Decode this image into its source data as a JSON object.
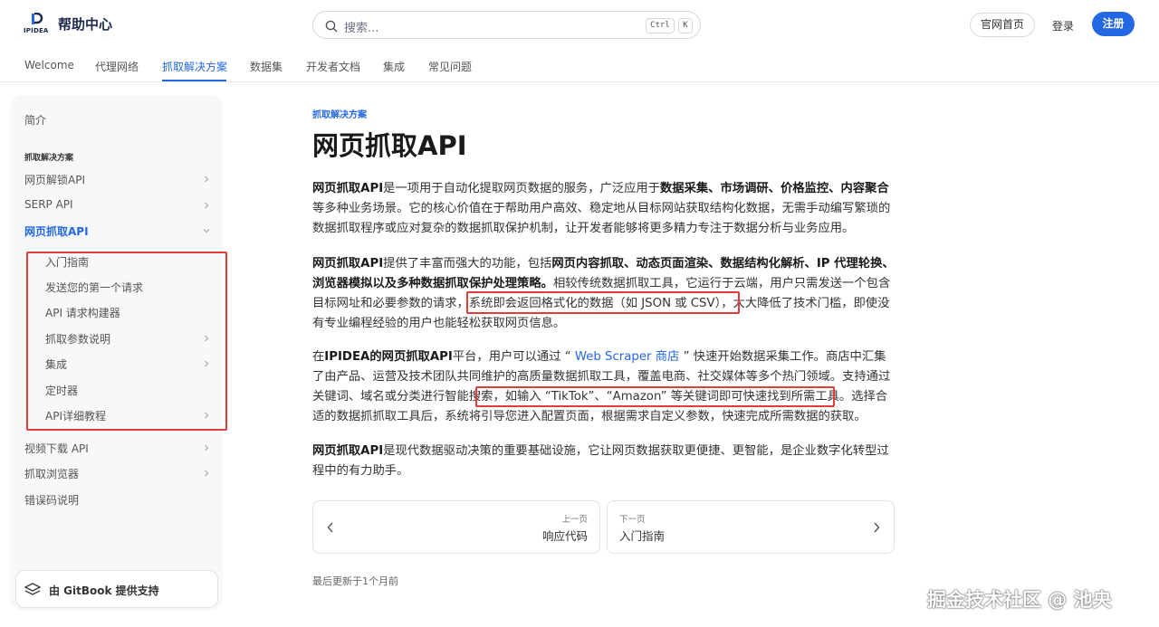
{
  "header": {
    "logo_text": "IPIDEA",
    "site_title": "帮助中心",
    "search_placeholder": "搜索...",
    "kbd_ctrl": "Ctrl",
    "kbd_k": "K",
    "official_site": "官网首页",
    "login": "登录",
    "register": "注册",
    "accent_color": "#2467e3"
  },
  "nav": {
    "items": [
      "Welcome",
      "代理网络",
      "抓取解决方案",
      "数据集",
      "开发者文档",
      "集成",
      "常见问题"
    ],
    "active": "抓取解决方案"
  },
  "sidebar": {
    "intro": "简介",
    "section": "抓取解决方案",
    "items": [
      "网页解锁API",
      "SERP API",
      "网页抓取API"
    ],
    "sub_items": [
      "入门指南",
      "发送您的第一个请求",
      "API 请求构建器",
      "抓取参数说明",
      "集成",
      "定时器",
      "API详细教程"
    ],
    "bottom_items": [
      "视频下载 API",
      "抓取浏览器",
      "错误码说明"
    ],
    "gitbook": "由 GitBook 提供支持"
  },
  "main": {
    "breadcrumb": "抓取解决方案",
    "title": "网页抓取API",
    "p1": {
      "a": "网页抓取API",
      "b": "是一项用于自动化提取网页数据的服务，广泛应用于",
      "c": "数据采集、市场调研、价格监控、内容聚合",
      "d": "等多种业务场景。它的核心价值在于帮助用户高效、稳定地从目标网站获取结构化数据，无需手动编写繁琐的数据抓取程序或应对复杂的数据抓取保护机制，让开发者能够将更多精力专注于数据分析与业务应用。"
    },
    "p2": {
      "a": "网页抓取API",
      "b": "提供了丰富而强大的功能，包括",
      "c": "网页内容抓取、动态页面渲染、数据结构化解析、IP 代理轮换、浏览器模拟以及多种数据抓取保护处理策略。",
      "d": "相较传统数据抓取工具，它运行于云端，用户只需发送一个包含目标网址和必要参数的请求，",
      "e": "系统即会返回格式化的数据（如 JSON 或 CSV）",
      "f": "，大大降低了技术门槛，即使没有专业编程经验的用户也能轻松获取网页信息。"
    },
    "p3": {
      "a": "在",
      "b": "IPIDEA的网页抓取API",
      "c": "平台，用户可以通过 “ ",
      "link": "Web Scraper 商店",
      "d": " ” 快速开始数据采集工作。商店中汇集了由产品、运营及技术团队共同维护的高质量数据抓取工具，覆盖电商、社交媒体等多个热门领域。支持通过关键词、域名或分类进行智能搜索，",
      "e": "如输入 “TikTok”、“Amazon” 等关键词即可快速找到所需工具。",
      "f": "选择合适的数据抓抓取工具后，系统将引导您进入配置页面，根据需求自定义参数，快速完成所需数据的获取。"
    },
    "p4": {
      "a": "网页抓取API",
      "b": "是现代数据驱动决策的重要基础设施，它让网页数据获取更便捷、更智能，是企业数字化转型过程中的有力助手。"
    },
    "prev_small": "上一页",
    "prev_big": "响应代码",
    "next_small": "下一页",
    "next_big": "入门指南",
    "updated": "最后更新于1个月前"
  },
  "watermark": "掘金技术社区 @ 池央"
}
